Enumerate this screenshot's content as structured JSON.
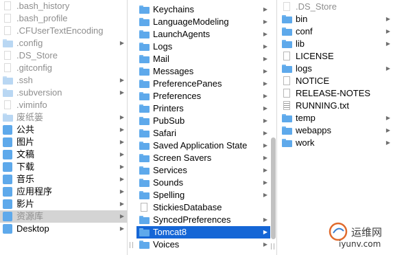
{
  "column1": {
    "items": [
      {
        "label": ".bash_history",
        "icon": "document-icon",
        "dim": true
      },
      {
        "label": ".bash_profile",
        "icon": "document-icon",
        "dim": true
      },
      {
        "label": ".CFUserTextEncoding",
        "icon": "document-icon",
        "dim": true
      },
      {
        "label": ".config",
        "icon": "folder-icon",
        "dim": true,
        "arrow": "▶"
      },
      {
        "label": ".DS_Store",
        "icon": "document-icon",
        "dim": true
      },
      {
        "label": ".gitconfig",
        "icon": "document-icon",
        "dim": true
      },
      {
        "label": ".ssh",
        "icon": "folder-icon",
        "dim": true,
        "arrow": "▶"
      },
      {
        "label": ".subversion",
        "icon": "folder-icon",
        "dim": true,
        "arrow": "▶"
      },
      {
        "label": ".viminfo",
        "icon": "document-icon",
        "dim": true
      },
      {
        "label": "废纸篓",
        "icon": "folder-icon",
        "dim": true,
        "arrow": "▶"
      },
      {
        "label": "公共",
        "icon": "public-folder-icon",
        "arrow": "▶"
      },
      {
        "label": "图片",
        "icon": "pictures-folder-icon",
        "arrow": "▶"
      },
      {
        "label": "文稿",
        "icon": "documents-folder-icon",
        "arrow": "▶"
      },
      {
        "label": "下载",
        "icon": "downloads-folder-icon",
        "arrow": "▶"
      },
      {
        "label": "音乐",
        "icon": "music-folder-icon",
        "arrow": "▶"
      },
      {
        "label": "应用程序",
        "icon": "applications-folder-icon",
        "arrow": "▶"
      },
      {
        "label": "影片",
        "icon": "movies-folder-icon",
        "arrow": "▶"
      },
      {
        "label": "资源库",
        "icon": "library-folder-icon",
        "dim": true,
        "arrow": "▶",
        "selected": "inactive"
      },
      {
        "label": "Desktop",
        "icon": "desktop-folder-icon",
        "arrow": "▶"
      }
    ]
  },
  "column2": {
    "items": [
      {
        "label": "Keychains",
        "icon": "folder-icon",
        "arrow": "▶"
      },
      {
        "label": "LanguageModeling",
        "icon": "folder-icon",
        "arrow": "▶"
      },
      {
        "label": "LaunchAgents",
        "icon": "folder-icon",
        "arrow": "▶"
      },
      {
        "label": "Logs",
        "icon": "folder-icon",
        "arrow": "▶"
      },
      {
        "label": "Mail",
        "icon": "folder-icon",
        "arrow": "▶"
      },
      {
        "label": "Messages",
        "icon": "folder-icon",
        "arrow": "▶"
      },
      {
        "label": "PreferencePanes",
        "icon": "folder-icon",
        "arrow": "▶"
      },
      {
        "label": "Preferences",
        "icon": "folder-icon",
        "arrow": "▶"
      },
      {
        "label": "Printers",
        "icon": "folder-icon",
        "arrow": "▶"
      },
      {
        "label": "PubSub",
        "icon": "folder-icon",
        "arrow": "▶"
      },
      {
        "label": "Safari",
        "icon": "folder-icon",
        "arrow": "▶"
      },
      {
        "label": "Saved Application State",
        "icon": "folder-icon",
        "arrow": "▶"
      },
      {
        "label": "Screen Savers",
        "icon": "folder-icon",
        "arrow": "▶"
      },
      {
        "label": "Services",
        "icon": "folder-icon",
        "arrow": "▶"
      },
      {
        "label": "Sounds",
        "icon": "folder-icon",
        "arrow": "▶"
      },
      {
        "label": "Spelling",
        "icon": "folder-icon",
        "arrow": "▶"
      },
      {
        "label": "StickiesDatabase",
        "icon": "document-icon"
      },
      {
        "label": "SyncedPreferences",
        "icon": "folder-icon",
        "arrow": "▶"
      },
      {
        "label": "Tomcat8",
        "icon": "folder-icon",
        "arrow": "▶",
        "selected": "active"
      },
      {
        "label": "Voices",
        "icon": "folder-icon",
        "arrow": "▶"
      }
    ]
  },
  "column3": {
    "items": [
      {
        "label": ".DS_Store",
        "icon": "document-icon",
        "dim": true
      },
      {
        "label": "bin",
        "icon": "folder-icon",
        "arrow": "▶"
      },
      {
        "label": "conf",
        "icon": "folder-icon",
        "arrow": "▶"
      },
      {
        "label": "lib",
        "icon": "folder-icon",
        "arrow": "▶"
      },
      {
        "label": "LICENSE",
        "icon": "document-icon"
      },
      {
        "label": "logs",
        "icon": "folder-icon",
        "arrow": "▶"
      },
      {
        "label": "NOTICE",
        "icon": "document-icon"
      },
      {
        "label": "RELEASE-NOTES",
        "icon": "document-icon"
      },
      {
        "label": "RUNNING.txt",
        "icon": "text-document-icon"
      },
      {
        "label": "temp",
        "icon": "folder-icon",
        "arrow": "▶"
      },
      {
        "label": "webapps",
        "icon": "folder-icon",
        "arrow": "▶"
      },
      {
        "label": "work",
        "icon": "folder-icon",
        "arrow": "▶"
      }
    ]
  },
  "resize_handle": "||",
  "watermark": {
    "cn": "运维网",
    "url": "iyunv.com"
  },
  "colors": {
    "selection_active": "#1566d6",
    "selection_inactive": "#d4d4d4",
    "folder": "#5ea9eb"
  }
}
